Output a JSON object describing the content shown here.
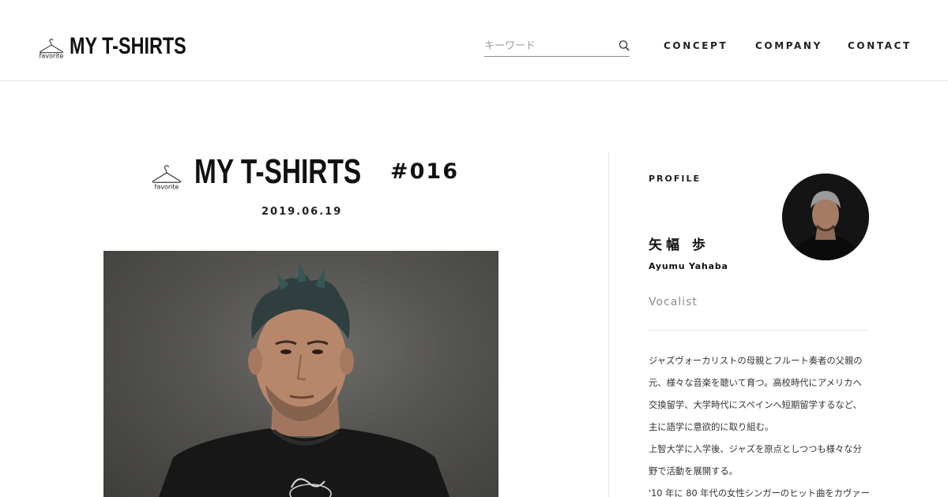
{
  "header": {
    "logo_hanger_text": "favorite",
    "logo_text": "MY T-SHIRTS",
    "search_placeholder": "キーワード",
    "nav": [
      "CONCEPT",
      "COMPANY",
      "CONTACT"
    ]
  },
  "article": {
    "logo_hanger_text": "favorite",
    "logo_text": "MY T-SHIRTS",
    "issue": "#016",
    "date": "2019.06.19"
  },
  "profile": {
    "label": "PROFILE",
    "name_jp": "矢幅 歩",
    "name_en": "Ayumu Yahaba",
    "role": "Vocalist",
    "bio_lines": [
      "ジャズヴォーカリストの母親とフルート奏者の父親の",
      "元、様々な音楽を聴いて育つ。高校時代にアメリカへ",
      "交換留学、大学時代にスペインへ短期留学するなど、",
      "主に語学に意欲的に取り組む。",
      "上智大学に入学後、ジャズを原点としつつも様々な分",
      "野で活動を展開する。",
      "'10 年に 80 年代の女性シンガーのヒット曲をカヴァー"
    ]
  },
  "colors": {
    "text": "#111111",
    "muted": "#8e8e8e",
    "rule": "#e6e6e6",
    "photo_bg": "#54534f"
  }
}
